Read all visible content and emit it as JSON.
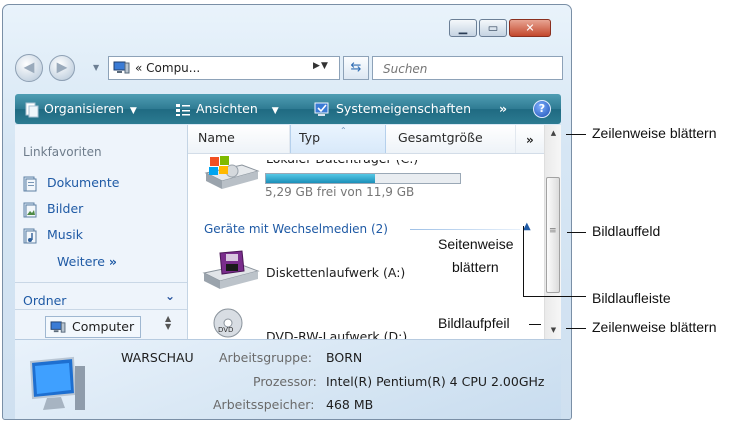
{
  "toolbar": {
    "organize": "Organisieren",
    "views": "Ansichten",
    "system": "Systemeigenschaften",
    "more": "»",
    "help": "?"
  },
  "address": {
    "path": "« Compu...",
    "search_placeholder": "Suchen"
  },
  "nav": {
    "favorites_header": "Linkfavoriten",
    "links": [
      "Dokumente",
      "Bilder",
      "Musik"
    ],
    "more": "Weitere",
    "more_glyph": "»",
    "folders": "Ordner",
    "computer": "Computer"
  },
  "columns": [
    "Name",
    "Typ",
    "Gesamtgröße"
  ],
  "column_more": "»",
  "content": {
    "local_drive_name": "Lokaler Datenträger (C:)",
    "local_drive_fill": 0.56,
    "local_drive_free": "5,29 GB frei von 11,9 GB",
    "group_label": "Geräte mit Wechselmedien (2)",
    "floppy": "Diskettenlaufwerk (A:)",
    "dvd": "DVD-RW-Laufwerk (D:)"
  },
  "details": {
    "computer_name": "WARSCHAU",
    "workgroup_label": "Arbeitsgruppe:",
    "workgroup": "BORN",
    "cpu_label": "Prozessor:",
    "cpu": "Intel(R) Pentium(R) 4 CPU 2.00GHz",
    "ram_label": "Arbeitsspeicher:",
    "ram": "468 MB"
  },
  "annotations": {
    "line_scroll_top": "Zeilenweise blättern",
    "scroll_box": "Bildlauffeld",
    "page_scroll_1": "Seitenweise",
    "page_scroll_2": "blättern",
    "scrollbar": "Bildlaufleiste",
    "scroll_arrow": "Bildlaufpfeil",
    "line_scroll_bottom": "Zeilenweise blättern"
  },
  "colors": {
    "toolbar": "#2f7b93",
    "link": "#1f5aa5",
    "close": "#c3472c"
  }
}
